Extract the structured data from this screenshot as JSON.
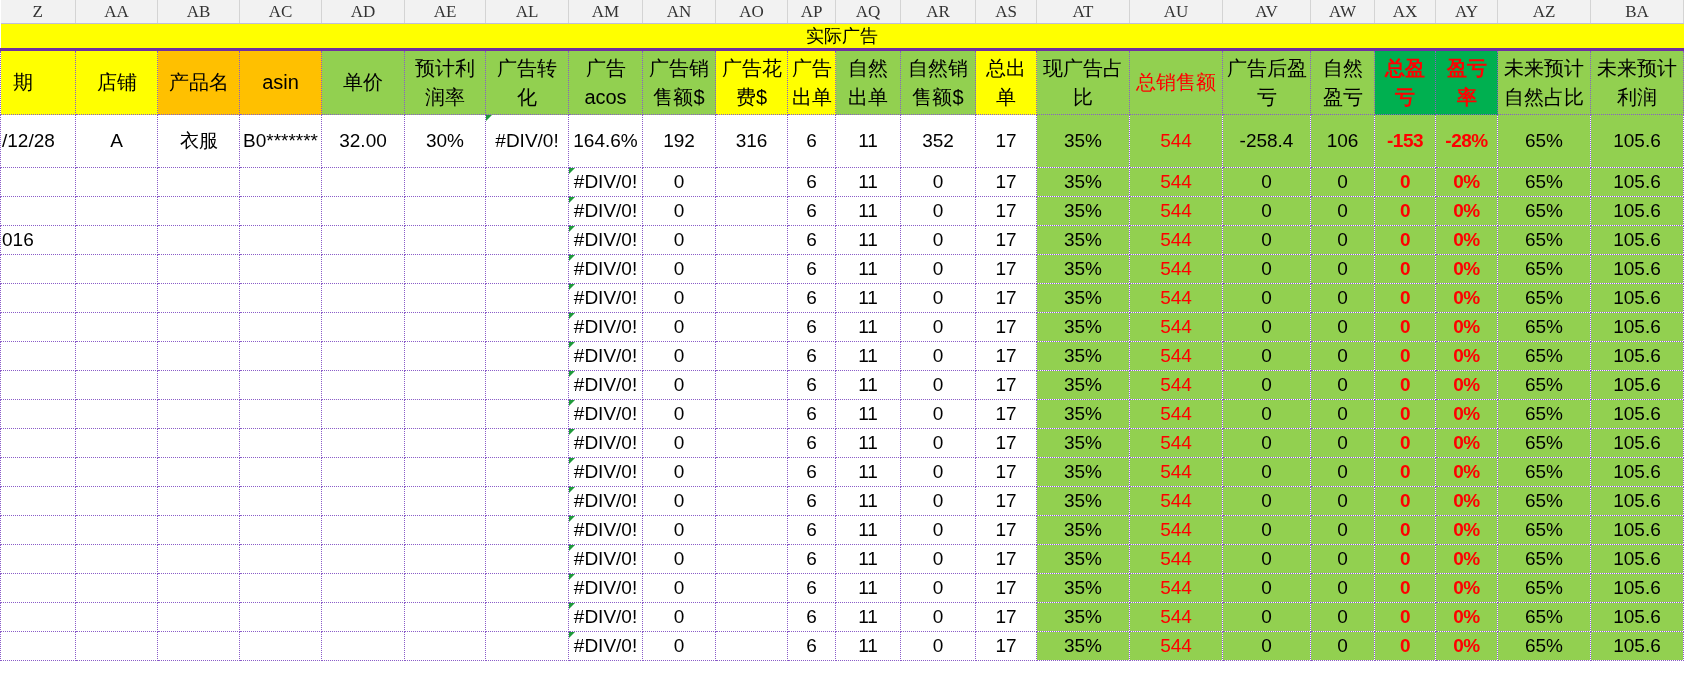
{
  "banner": "实际广告",
  "columns": [
    {
      "letter": "Z",
      "header": "期",
      "color": "#ffff00",
      "kind": "input"
    },
    {
      "letter": "AA",
      "header": "店铺",
      "color": "#ffff00",
      "kind": "input"
    },
    {
      "letter": "AB",
      "header": "产品名",
      "color": "#ffc000",
      "kind": "input"
    },
    {
      "letter": "AC",
      "header": "asin",
      "color": "#ffc000",
      "kind": "input"
    },
    {
      "letter": "AD",
      "header": "单价",
      "color": "#92d050",
      "kind": "input"
    },
    {
      "letter": "AE",
      "header": "预计利润率",
      "color": "#92d050",
      "kind": "input"
    },
    {
      "letter": "AL",
      "header": "广告转化",
      "color": "#92d050",
      "kind": "input"
    },
    {
      "letter": "AM",
      "header": "广告acos",
      "color": "#92d050",
      "kind": "input"
    },
    {
      "letter": "AN",
      "header": "广告销售额$",
      "color": "#92d050",
      "kind": "input"
    },
    {
      "letter": "AO",
      "header": "广告花费$",
      "color": "#ffff00",
      "kind": "input"
    },
    {
      "letter": "AP",
      "header": "广告出单",
      "color": "#ffff00",
      "kind": "input"
    },
    {
      "letter": "AQ",
      "header": "自然出单",
      "color": "#92d050",
      "kind": "input"
    },
    {
      "letter": "AR",
      "header": "自然销售额$",
      "color": "#92d050",
      "kind": "input"
    },
    {
      "letter": "AS",
      "header": "总出单",
      "color": "#ffff00",
      "kind": "input"
    },
    {
      "letter": "AT",
      "header": "现广告占比",
      "color": "#92d050",
      "kind": "calc"
    },
    {
      "letter": "AU",
      "header": "总销售额",
      "color": "#92d050",
      "kind": "calc_red"
    },
    {
      "letter": "AV",
      "header": "广告后盈亏",
      "color": "#92d050",
      "kind": "calc"
    },
    {
      "letter": "AW",
      "header": "自然盈亏",
      "color": "#92d050",
      "kind": "calc"
    },
    {
      "letter": "AX",
      "header": "总盈亏",
      "color": "#00b050",
      "kind": "calc_alert"
    },
    {
      "letter": "AY",
      "header": "盈亏率",
      "color": "#00b050",
      "kind": "calc_alert"
    },
    {
      "letter": "AZ",
      "header": "未来预计自然占比",
      "color": "#92d050",
      "kind": "calc"
    },
    {
      "letter": "BA",
      "header": "未来预计利润",
      "color": "#92d050",
      "kind": "calc"
    }
  ],
  "rows": [
    {
      "cells": [
        "/12/28",
        "A",
        "衣服",
        "B0*******",
        "32.00",
        "30%",
        {
          "text": "#DIV/0!",
          "error": true
        },
        "164.6%",
        "192",
        "316",
        "6",
        "11",
        "352",
        "17",
        "35%",
        "544",
        "-258.4",
        "106",
        "-153",
        "-28%",
        "65%",
        "105.6"
      ]
    },
    {
      "cells": [
        null,
        null,
        null,
        null,
        null,
        null,
        null,
        {
          "text": "#DIV/0!",
          "error": true
        },
        "0",
        null,
        "6",
        "11",
        "0",
        "17",
        "35%",
        "544",
        "0",
        "0",
        "0",
        "0%",
        "65%",
        "105.6"
      ]
    },
    {
      "cells": [
        null,
        null,
        null,
        null,
        null,
        null,
        null,
        {
          "text": "#DIV/0!",
          "error": true
        },
        "0",
        null,
        "6",
        "11",
        "0",
        "17",
        "35%",
        "544",
        "0",
        "0",
        "0",
        "0%",
        "65%",
        "105.6"
      ]
    },
    {
      "cells": [
        "016",
        null,
        null,
        null,
        null,
        null,
        null,
        {
          "text": "#DIV/0!",
          "error": true
        },
        "0",
        null,
        "6",
        "11",
        "0",
        "17",
        "35%",
        "544",
        "0",
        "0",
        "0",
        "0%",
        "65%",
        "105.6"
      ]
    },
    {
      "cells": [
        null,
        null,
        null,
        null,
        null,
        null,
        null,
        {
          "text": "#DIV/0!",
          "error": true
        },
        "0",
        null,
        "6",
        "11",
        "0",
        "17",
        "35%",
        "544",
        "0",
        "0",
        "0",
        "0%",
        "65%",
        "105.6"
      ]
    },
    {
      "cells": [
        null,
        null,
        null,
        null,
        null,
        null,
        null,
        {
          "text": "#DIV/0!",
          "error": true
        },
        "0",
        null,
        "6",
        "11",
        "0",
        "17",
        "35%",
        "544",
        "0",
        "0",
        "0",
        "0%",
        "65%",
        "105.6"
      ]
    },
    {
      "cells": [
        null,
        null,
        null,
        null,
        null,
        null,
        null,
        {
          "text": "#DIV/0!",
          "error": true
        },
        "0",
        null,
        "6",
        "11",
        "0",
        "17",
        "35%",
        "544",
        "0",
        "0",
        "0",
        "0%",
        "65%",
        "105.6"
      ]
    },
    {
      "cells": [
        null,
        null,
        null,
        null,
        null,
        null,
        null,
        {
          "text": "#DIV/0!",
          "error": true
        },
        "0",
        null,
        "6",
        "11",
        "0",
        "17",
        "35%",
        "544",
        "0",
        "0",
        "0",
        "0%",
        "65%",
        "105.6"
      ]
    },
    {
      "cells": [
        null,
        null,
        null,
        null,
        null,
        null,
        null,
        {
          "text": "#DIV/0!",
          "error": true
        },
        "0",
        null,
        "6",
        "11",
        "0",
        "17",
        "35%",
        "544",
        "0",
        "0",
        "0",
        "0%",
        "65%",
        "105.6"
      ]
    },
    {
      "cells": [
        null,
        null,
        null,
        null,
        null,
        null,
        null,
        {
          "text": "#DIV/0!",
          "error": true
        },
        "0",
        null,
        "6",
        "11",
        "0",
        "17",
        "35%",
        "544",
        "0",
        "0",
        "0",
        "0%",
        "65%",
        "105.6"
      ]
    },
    {
      "cells": [
        null,
        null,
        null,
        null,
        null,
        null,
        null,
        {
          "text": "#DIV/0!",
          "error": true
        },
        "0",
        null,
        "6",
        "11",
        "0",
        "17",
        "35%",
        "544",
        "0",
        "0",
        "0",
        "0%",
        "65%",
        "105.6"
      ]
    },
    {
      "cells": [
        null,
        null,
        null,
        null,
        null,
        null,
        null,
        {
          "text": "#DIV/0!",
          "error": true
        },
        "0",
        null,
        "6",
        "11",
        "0",
        "17",
        "35%",
        "544",
        "0",
        "0",
        "0",
        "0%",
        "65%",
        "105.6"
      ]
    },
    {
      "cells": [
        null,
        null,
        null,
        null,
        null,
        null,
        null,
        {
          "text": "#DIV/0!",
          "error": true
        },
        "0",
        null,
        "6",
        "11",
        "0",
        "17",
        "35%",
        "544",
        "0",
        "0",
        "0",
        "0%",
        "65%",
        "105.6"
      ]
    },
    {
      "cells": [
        null,
        null,
        null,
        null,
        null,
        null,
        null,
        {
          "text": "#DIV/0!",
          "error": true
        },
        "0",
        null,
        "6",
        "11",
        "0",
        "17",
        "35%",
        "544",
        "0",
        "0",
        "0",
        "0%",
        "65%",
        "105.6"
      ]
    },
    {
      "cells": [
        null,
        null,
        null,
        null,
        null,
        null,
        null,
        {
          "text": "#DIV/0!",
          "error": true
        },
        "0",
        null,
        "6",
        "11",
        "0",
        "17",
        "35%",
        "544",
        "0",
        "0",
        "0",
        "0%",
        "65%",
        "105.6"
      ]
    },
    {
      "cells": [
        null,
        null,
        null,
        null,
        null,
        null,
        null,
        {
          "text": "#DIV/0!",
          "error": true
        },
        "0",
        null,
        "6",
        "11",
        "0",
        "17",
        "35%",
        "544",
        "0",
        "0",
        "0",
        "0%",
        "65%",
        "105.6"
      ]
    },
    {
      "cells": [
        null,
        null,
        null,
        null,
        null,
        null,
        null,
        {
          "text": "#DIV/0!",
          "error": true
        },
        "0",
        null,
        "6",
        "11",
        "0",
        "17",
        "35%",
        "544",
        "0",
        "0",
        "0",
        "0%",
        "65%",
        "105.6"
      ]
    },
    {
      "cells": [
        null,
        null,
        null,
        null,
        null,
        null,
        null,
        {
          "text": "#DIV/0!",
          "error": true
        },
        "0",
        null,
        "6",
        "11",
        "0",
        "17",
        "35%",
        "544",
        "0",
        "0",
        "0",
        "0%",
        "65%",
        "105.6"
      ]
    }
  ]
}
